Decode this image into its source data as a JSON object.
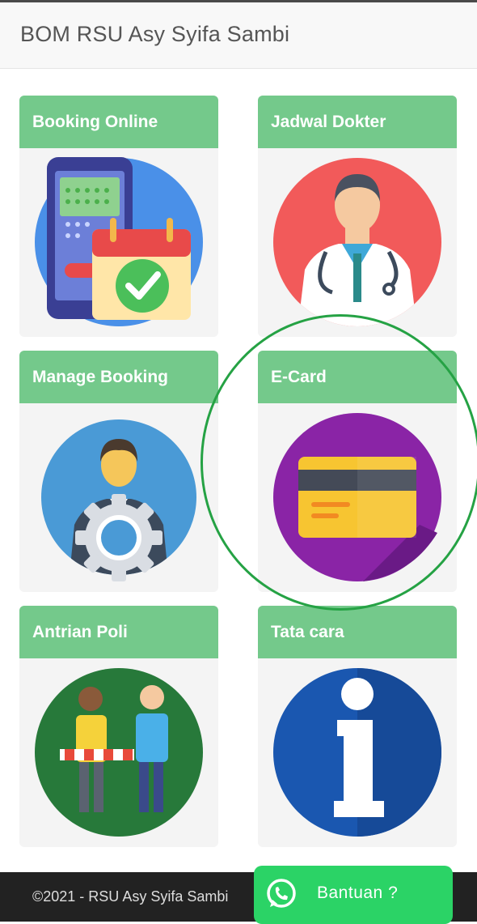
{
  "header": {
    "title": "BOM RSU Asy Syifa Sambi"
  },
  "menu": [
    {
      "label": "Booking Online",
      "icon": "calendar-phone-icon"
    },
    {
      "label": "Jadwal Dokter",
      "icon": "doctor-icon"
    },
    {
      "label": "Manage Booking",
      "icon": "manager-gear-icon"
    },
    {
      "label": "E-Card",
      "icon": "credit-card-icon"
    },
    {
      "label": "Antrian Poli",
      "icon": "queue-people-icon"
    },
    {
      "label": "Tata cara",
      "icon": "info-icon"
    }
  ],
  "footer": {
    "copyright": "©2021 - RSU Asy Syifa Sambi"
  },
  "help_button": {
    "label": "Bantuan ?",
    "icon": "whatsapp-icon"
  },
  "colors": {
    "card_header": "#74c98b",
    "highlight_circle": "#25a244",
    "whatsapp_green": "#2bd366",
    "footer_bg": "#222222"
  }
}
